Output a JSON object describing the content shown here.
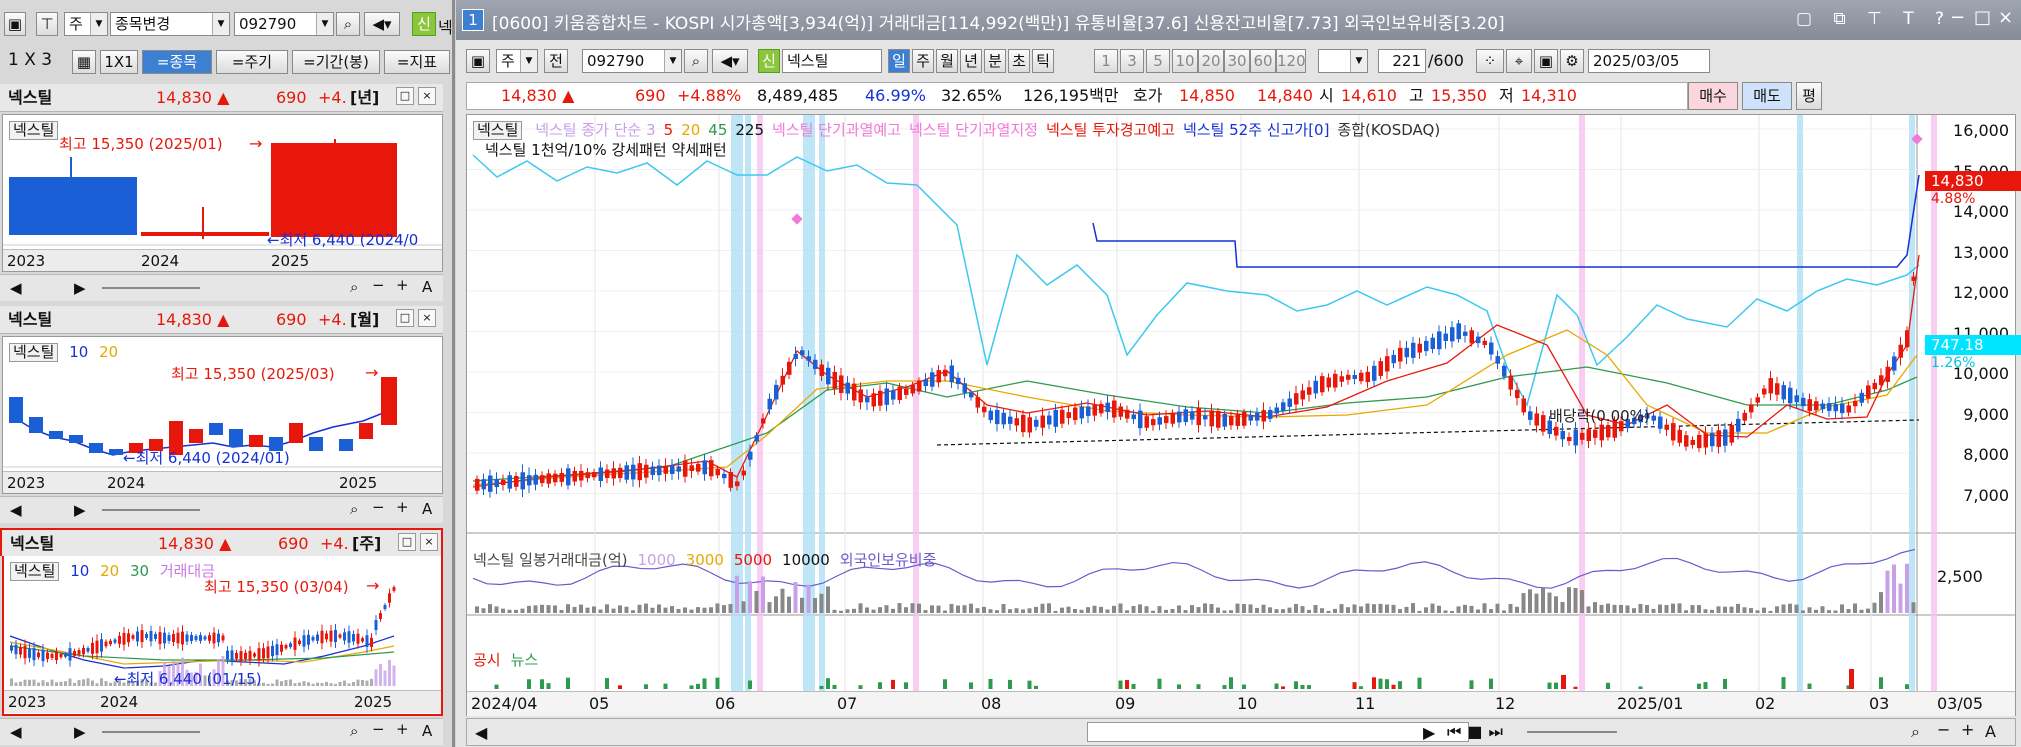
{
  "left": {
    "toolbar": {
      "type_label": "주",
      "change_label": "종목변경",
      "code": "092790",
      "trade_icon_label": "신",
      "name_short": "넥"
    },
    "layout_bar": {
      "grid_label": "1 X 3",
      "one_by_one": "1X1",
      "by_stock": "=종목",
      "by_period": "=주기",
      "by_range": "=기간(봉)",
      "by_indicator": "=지표"
    },
    "panels": [
      {
        "name": "넥스틸",
        "price": "14,830 ▲",
        "change": "690",
        "rate": "+4.",
        "period": "[년]",
        "legend_tag": "넥스틸",
        "high_label": "최고 15,350 (2025/01)",
        "low_label": "←최저 6,440 (2024/0",
        "years": [
          "2023",
          "2024",
          "2025"
        ]
      },
      {
        "name": "넥스틸",
        "price": "14,830 ▲",
        "change": "690",
        "rate": "+4.",
        "period": "[월]",
        "legend_tag": "넥스틸",
        "ma1": "10",
        "ma2": "20",
        "high_label": "최고 15,350 (2025/03)",
        "low_label": "←최저 6,440 (2024/01)",
        "years": [
          "2023",
          "2024",
          "2025"
        ]
      },
      {
        "name": "넥스틸",
        "price": "14,830 ▲",
        "change": "690",
        "rate": "+4.",
        "period": "[주]",
        "legend_tag": "넥스틸",
        "ma1": "10",
        "ma2": "20",
        "ma3": "30",
        "vol_label": "거래대금",
        "high_label": "최고 15,350 (03/04)",
        "low_label": "←최저 6,440 (01/15)",
        "years": [
          "2023",
          "2024",
          "2025"
        ]
      }
    ]
  },
  "window": {
    "number": "1",
    "title": "[0600] 키움종합차트 - KOSPI 시가총액[3,934(억)] 거래대금[114,992(백만)] 유통비율[37.6] 신용잔고비율[7.73] 외국인보유비중[3.20]"
  },
  "main_toolbar": {
    "type_label": "주",
    "prev_label": "전",
    "code": "092790",
    "trade_icon_label": "신",
    "stock_name": "넥스틸",
    "periods": [
      "일",
      "주",
      "월",
      "년",
      "분",
      "초",
      "틱"
    ],
    "intervals": [
      "1",
      "3",
      "5",
      "10",
      "20",
      "30",
      "60",
      "120"
    ],
    "count": "221",
    "count_total": "/600",
    "date": "2025/03/05"
  },
  "quote": {
    "price": "14,830 ▲",
    "change": "690",
    "rate": "+4.88%",
    "volume": "8,489,485",
    "pct1": "46.99%",
    "pct2": "32.65%",
    "amount": "126,195백만",
    "hoga_label": "호가",
    "ask": "14,850",
    "bid": "14,840",
    "open_label": "시",
    "open": "14,610",
    "high_label": "고",
    "high": "15,350",
    "low_label": "저",
    "low": "14,310",
    "buy": "매수",
    "sell": "매도",
    "eval": "평"
  },
  "chart": {
    "legend_tag": "넥스틸",
    "legend_line1": [
      {
        "text": "넥스틸 종가 단순 3",
        "color": "#c8a0e8"
      },
      {
        "text": "5",
        "color": "#e8170b"
      },
      {
        "text": "20",
        "color": "#e8a800"
      },
      {
        "text": "45",
        "color": "#2e9a4e"
      },
      {
        "text": "225",
        "color": "#111111"
      },
      {
        "text": "넥스틸 단기과열예고",
        "color": "#f07ad6"
      },
      {
        "text": "넥스틸 단기과열지정",
        "color": "#f07ad6"
      },
      {
        "text": "넥스틸 투자경고예고",
        "color": "#e8170b"
      },
      {
        "text": "넥스틸 52주 신고가[0]",
        "color": "#1530d6"
      },
      {
        "text": "종합(KOSDAQ)",
        "color": "#333333"
      }
    ],
    "legend_line2": "넥스틸 1천억/10% 강세패턴  약세패턴",
    "dividend_label": "배당락(0.00%)",
    "y_ticks": [
      "16,000",
      "15,000",
      "14,000",
      "13,000",
      "12,000",
      "11,000",
      "10,000",
      "9,000",
      "8,000",
      "7,000"
    ],
    "price_tag": "14,830",
    "price_rate_tag": "4.88%",
    "index_tag": "747.18",
    "index_rate_tag": "1.26%",
    "volume_legend": [
      {
        "text": "넥스틸 일봉거래대금(억)",
        "color": "#444444"
      },
      {
        "text": "1000",
        "color": "#c8a0e8"
      },
      {
        "text": "3000",
        "color": "#e8a800"
      },
      {
        "text": "5000",
        "color": "#e8170b"
      },
      {
        "text": "10000",
        "color": "#111111"
      },
      {
        "text": "외국인보유비중",
        "color": "#6a5acd"
      }
    ],
    "volume_tick": "2,500",
    "news_legend": [
      {
        "text": "공시",
        "color": "#e8170b"
      },
      {
        "text": "뉴스",
        "color": "#2e9a4e"
      }
    ],
    "x_ticks": [
      "2024/04",
      "05",
      "06",
      "07",
      "08",
      "09",
      "10",
      "11",
      "12",
      "2025/01",
      "02",
      "03",
      "03/05"
    ]
  }
}
